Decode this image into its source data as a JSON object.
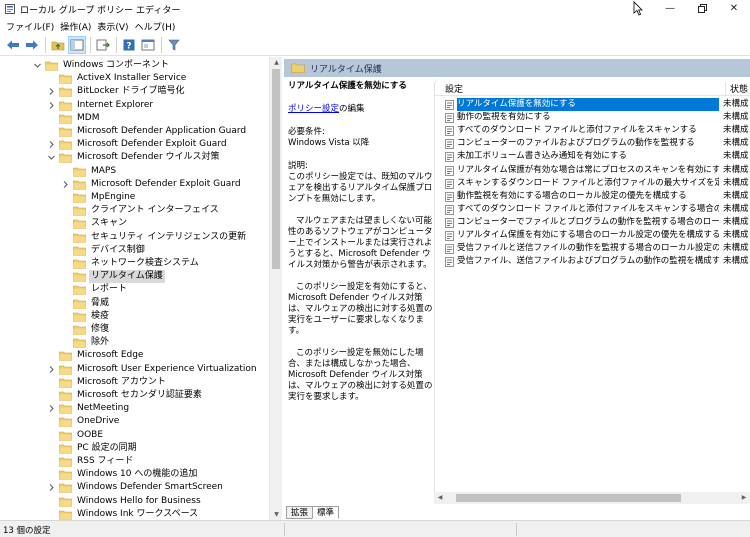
{
  "window": {
    "title": "ローカル グループ ポリシー エディター",
    "controls": [
      "minimize-icon",
      "restore-icon",
      "close-icon"
    ]
  },
  "menu": [
    "ファイル(F)",
    "操作(A)",
    "表示(V)",
    "ヘルプ(H)"
  ],
  "toolbar": [
    "back-arrow-icon",
    "forward-arrow-icon",
    "up-folder-icon",
    "show-tree-icon",
    "export-list-icon",
    "help-icon",
    "properties-icon",
    "filter-icon"
  ],
  "tree": [
    {
      "label": "Windows コンポーネント",
      "level": 0,
      "expand": "open"
    },
    {
      "label": "ActiveX Installer Service",
      "level": 1,
      "expand": "none"
    },
    {
      "label": "BitLocker ドライブ暗号化",
      "level": 1,
      "expand": "closed"
    },
    {
      "label": "Internet Explorer",
      "level": 1,
      "expand": "closed"
    },
    {
      "label": "MDM",
      "level": 1,
      "expand": "none"
    },
    {
      "label": "Microsoft Defender Application Guard",
      "level": 1,
      "expand": "none"
    },
    {
      "label": "Microsoft Defender Exploit Guard",
      "level": 1,
      "expand": "closed"
    },
    {
      "label": "Microsoft Defender ウイルス対策",
      "level": 1,
      "expand": "open"
    },
    {
      "label": "MAPS",
      "level": 2,
      "expand": "none"
    },
    {
      "label": "Microsoft Defender Exploit Guard",
      "level": 2,
      "expand": "closed"
    },
    {
      "label": "MpEngine",
      "level": 2,
      "expand": "none"
    },
    {
      "label": "クライアント インターフェイス",
      "level": 2,
      "expand": "none"
    },
    {
      "label": "スキャン",
      "level": 2,
      "expand": "none"
    },
    {
      "label": "セキュリティ インテリジェンスの更新",
      "level": 2,
      "expand": "none"
    },
    {
      "label": "デバイス制御",
      "level": 2,
      "expand": "none"
    },
    {
      "label": "ネットワーク検査システム",
      "level": 2,
      "expand": "none"
    },
    {
      "label": "リアルタイム保護",
      "level": 2,
      "expand": "none",
      "selected": true
    },
    {
      "label": "レポート",
      "level": 2,
      "expand": "none"
    },
    {
      "label": "脅威",
      "level": 2,
      "expand": "none"
    },
    {
      "label": "検疫",
      "level": 2,
      "expand": "none"
    },
    {
      "label": "修復",
      "level": 2,
      "expand": "none"
    },
    {
      "label": "除外",
      "level": 2,
      "expand": "none"
    },
    {
      "label": "Microsoft Edge",
      "level": 1,
      "expand": "none"
    },
    {
      "label": "Microsoft User Experience Virtualization",
      "level": 1,
      "expand": "closed"
    },
    {
      "label": "Microsoft アカウント",
      "level": 1,
      "expand": "none"
    },
    {
      "label": "Microsoft セカンダリ認証要素",
      "level": 1,
      "expand": "none"
    },
    {
      "label": "NetMeeting",
      "level": 1,
      "expand": "closed"
    },
    {
      "label": "OneDrive",
      "level": 1,
      "expand": "none"
    },
    {
      "label": "OOBE",
      "level": 1,
      "expand": "none"
    },
    {
      "label": "PC 設定の同期",
      "level": 1,
      "expand": "none"
    },
    {
      "label": "RSS フィード",
      "level": 1,
      "expand": "none"
    },
    {
      "label": "Windows 10 への機能の追加",
      "level": 1,
      "expand": "none"
    },
    {
      "label": "Windows Defender SmartScreen",
      "level": 1,
      "expand": "closed"
    },
    {
      "label": "Windows Hello for Business",
      "level": 1,
      "expand": "none"
    },
    {
      "label": "Windows Ink ワークスペース",
      "level": 1,
      "expand": "none"
    }
  ],
  "section": {
    "title": "リアルタイム保護"
  },
  "description": {
    "title": "リアルタイム保護を無効にする",
    "edit_link": "ポリシー設定",
    "edit_suffix": "の編集",
    "req_label": "必要条件:",
    "req_value": "Windows Vista 以降",
    "explain_label": "説明:",
    "p1": "このポリシー設定では、既知のマルウェアを検出するリアルタイム保護プロンプトを無効にします。",
    "p2": "マルウェアまたは望ましくない可能性のあるソフトウェアがコンピューター上でインストールまたは実行されようとすると、Microsoft Defender ウイルス対策から警告が表示されます。",
    "p3": "このポリシー設定を有効にすると、Microsoft Defender ウイルス対策は、マルウェアの検出に対する処置の実行をユーザーに要求しなくなります。",
    "p4": "このポリシー設定を無効にした場合、または構成しなかった場合、Microsoft Defender ウイルス対策は、マルウェアの検出に対する処置の実行を要求します。"
  },
  "list": {
    "col_setting": "設定",
    "col_state": "状態",
    "rows": [
      {
        "name": "リアルタイム保護を無効にする",
        "state": "未構成",
        "selected": true
      },
      {
        "name": "動作の監視を有効にする",
        "state": "未構成"
      },
      {
        "name": "すべてのダウンロード ファイルと添付ファイルをスキャンする",
        "state": "未構成"
      },
      {
        "name": "コンピューターのファイルおよびプログラムの動作を監視する",
        "state": "未構成"
      },
      {
        "name": "未加工ボリューム書き込み通知を有効にする",
        "state": "未構成"
      },
      {
        "name": "リアルタイム保護が有効な場合は常にプロセスのスキャンを有効にする",
        "state": "未構成"
      },
      {
        "name": "スキャンするダウンロード ファイルと添付ファイルの最大サイズを定義する",
        "state": "未構成"
      },
      {
        "name": "動作監視を有効にする場合のローカル設定の優先を構成する",
        "state": "未構成"
      },
      {
        "name": "すべてのダウンロード ファイルと添付ファイルをスキャンする場合のロー...",
        "state": "未構成"
      },
      {
        "name": "コンピューターでファイルとプログラムの動作を監視する場合のローカル...",
        "state": "未構成"
      },
      {
        "name": "リアルタイム保護を有効にする場合のローカル設定の優先を構成する",
        "state": "未構成"
      },
      {
        "name": "受信ファイルと送信ファイルの動作を監視する場合のローカル設定の...",
        "state": "未構成"
      },
      {
        "name": "受信ファイル、送信ファイルおよびプログラムの動作の監視を構成する",
        "state": "未構成"
      }
    ]
  },
  "tabs": [
    "拡張",
    "標準"
  ],
  "status": {
    "text": "13 個の設定"
  }
}
